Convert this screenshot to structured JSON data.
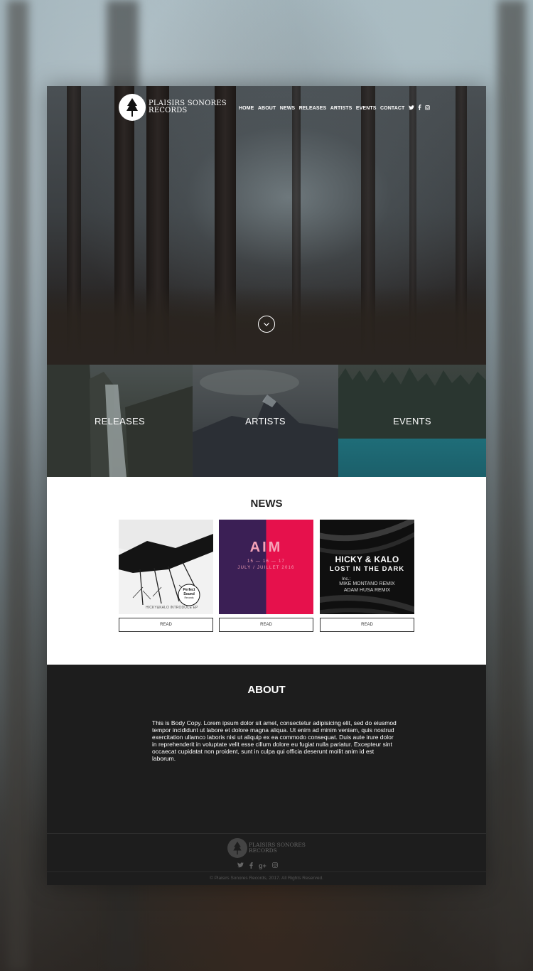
{
  "brand": {
    "name_line1": "PLAISIRS SONORES",
    "name_line2": "RECORDS"
  },
  "nav": {
    "items": [
      "HOME",
      "ABOUT",
      "NEWS",
      "RELEASES",
      "ARTISTS",
      "EVENTS",
      "CONTACT"
    ],
    "social_icons": [
      "twitter-icon",
      "facebook-icon",
      "instagram-icon"
    ]
  },
  "tiles": [
    {
      "label": "RELEASES"
    },
    {
      "label": "ARTISTS"
    },
    {
      "label": "EVENTS"
    }
  ],
  "news": {
    "title": "NEWS",
    "cards": [
      {
        "cover_text_badge_1": "Perfect",
        "cover_text_badge_2": "Sound",
        "cover_text_badge_3": "Records",
        "cover_caption": "HICKY&KALO INTRODUCE EP",
        "button_label": "READ"
      },
      {
        "cover_title": "AIM",
        "cover_dates": "15 — 16 — 17",
        "cover_month": "JULY / JUILLET 2016",
        "button_label": "READ"
      },
      {
        "cover_title_1": "HICKY & KALO",
        "cover_title_2": "LOST IN THE DARK",
        "cover_inc": "Inc.:",
        "cover_remix_1": "MIKE MONTANO REMIX",
        "cover_remix_2": "ADAM HUSA REMIX",
        "button_label": "READ"
      }
    ]
  },
  "about": {
    "title": "ABOUT",
    "body": "This is Body Copy. Lorem ipsum dolor sit amet, consectetur adipisicing elit, sed do eiusmod tempor incididunt ut labore et dolore magna aliqua. Ut enim ad minim veniam, quis nostrud exercitation ullamco laboris nisi ut aliquip ex ea commodo consequat. Duis aute irure dolor in reprehenderit in voluptate velit esse cillum dolore eu fugiat nulla pariatur. Excepteur sint occaecat cupidatat non proident, sunt in culpa qui officia deserunt mollit anim id est laborum."
  },
  "footer": {
    "brand_line1": "PLAISIRS SONORES",
    "brand_line2": "RECORDS",
    "social_icons": [
      "twitter-icon",
      "facebook-icon",
      "google-plus-icon",
      "instagram-icon"
    ],
    "copyright": "© Plaisirs Sonores Records, 2017. All Rights Reserved."
  },
  "colors": {
    "dark": "#1d1d1d",
    "aim_purple": "#3b1f55",
    "aim_red": "#e6114c",
    "lake": "#1f6d78"
  }
}
